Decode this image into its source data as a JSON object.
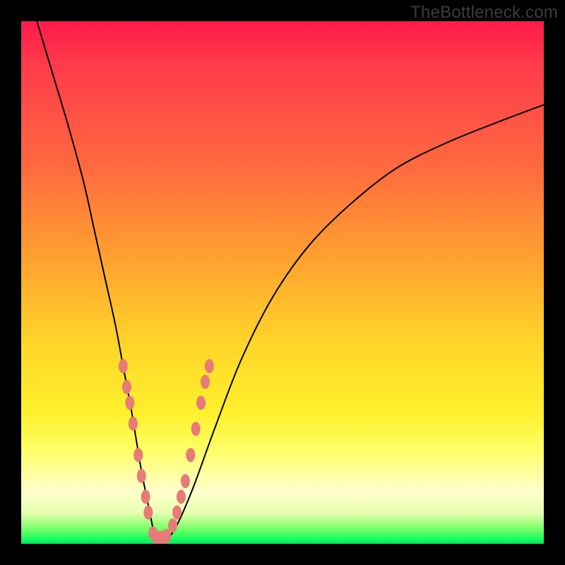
{
  "watermark": "TheBottleneck.com",
  "colors": {
    "frame": "#000000",
    "curve": "#000000",
    "dots": "#e77b77",
    "gradient_top": "#ff1a49",
    "gradient_mid": "#ffd629",
    "gradient_bottom": "#00e85b"
  },
  "chart_data": {
    "type": "line",
    "title": "",
    "xlabel": "",
    "ylabel": "",
    "xlim": [
      0,
      100
    ],
    "ylim": [
      0,
      100
    ],
    "grid": false,
    "legend": false,
    "note": "V-shaped bottleneck curve with vertex near the bottom; background is a vertical red→yellow→green gradient indicating bottleneck severity (red high, green low).",
    "series": [
      {
        "name": "bottleneck-curve",
        "x": [
          3,
          6,
          9,
          12,
          14,
          16,
          18,
          19.5,
          21,
          22,
          23,
          24,
          24.8,
          25.5,
          26.5,
          28,
          30,
          33,
          37,
          42,
          48,
          55,
          63,
          72,
          82,
          92,
          100
        ],
        "y": [
          100,
          90,
          80,
          69,
          60,
          51,
          42,
          34,
          26,
          20,
          14,
          9,
          5,
          2,
          1,
          1,
          4,
          11,
          22,
          35,
          47,
          57,
          65,
          72,
          77,
          81,
          84
        ]
      }
    ],
    "points": [
      {
        "name": "left-cluster-1",
        "x": 19.5,
        "y": 34
      },
      {
        "name": "left-cluster-2",
        "x": 20.2,
        "y": 30
      },
      {
        "name": "left-cluster-3",
        "x": 20.8,
        "y": 27
      },
      {
        "name": "left-cluster-4",
        "x": 21.4,
        "y": 23
      },
      {
        "name": "left-mid-1",
        "x": 22.4,
        "y": 17
      },
      {
        "name": "left-mid-2",
        "x": 23.0,
        "y": 13
      },
      {
        "name": "left-low-1",
        "x": 23.8,
        "y": 9
      },
      {
        "name": "left-low-2",
        "x": 24.3,
        "y": 6
      },
      {
        "name": "vertex-1",
        "x": 25.2,
        "y": 2
      },
      {
        "name": "vertex-2",
        "x": 26.0,
        "y": 1.2
      },
      {
        "name": "vertex-3",
        "x": 27.0,
        "y": 1.2
      },
      {
        "name": "vertex-4",
        "x": 27.8,
        "y": 1.5
      },
      {
        "name": "right-low-1",
        "x": 29.0,
        "y": 3.5
      },
      {
        "name": "right-low-2",
        "x": 29.8,
        "y": 6
      },
      {
        "name": "right-mid-1",
        "x": 30.6,
        "y": 9
      },
      {
        "name": "right-mid-2",
        "x": 31.4,
        "y": 12
      },
      {
        "name": "right-cluster-1",
        "x": 32.4,
        "y": 17
      },
      {
        "name": "right-cluster-2",
        "x": 33.4,
        "y": 22
      },
      {
        "name": "right-cluster-3",
        "x": 34.4,
        "y": 27
      },
      {
        "name": "right-cluster-4",
        "x": 35.2,
        "y": 31
      },
      {
        "name": "right-cluster-5",
        "x": 36.0,
        "y": 34
      }
    ]
  }
}
